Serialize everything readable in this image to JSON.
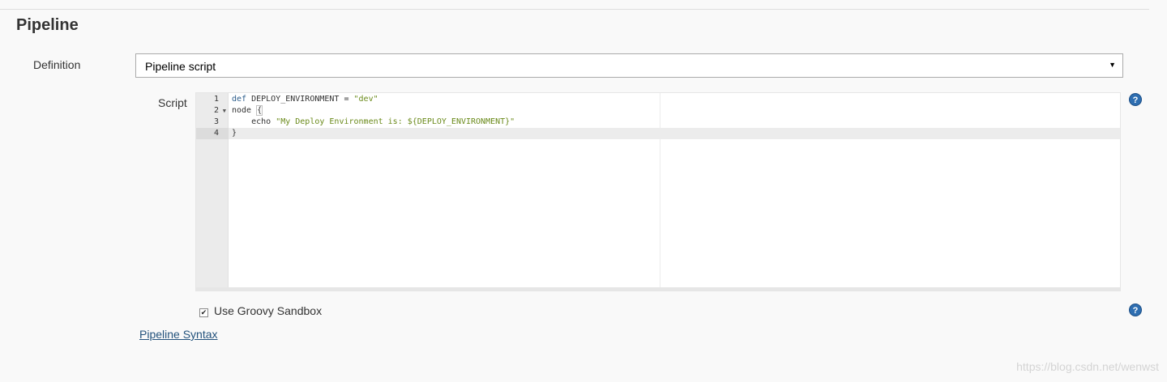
{
  "section": {
    "title": "Pipeline"
  },
  "definition": {
    "label": "Definition",
    "selected": "Pipeline script",
    "arrow": "▼"
  },
  "script": {
    "label": "Script",
    "lines": [
      {
        "num": "1",
        "tokens": [
          {
            "t": "def",
            "c": "kw"
          },
          {
            "t": " DEPLOY_ENVIRONMENT = ",
            "c": ""
          },
          {
            "t": "\"dev\"",
            "c": "str"
          }
        ]
      },
      {
        "num": "2",
        "fold": true,
        "tokens": [
          {
            "t": "node ",
            "c": ""
          },
          {
            "t": "{",
            "c": "brace"
          }
        ]
      },
      {
        "num": "3",
        "tokens": [
          {
            "t": "    echo ",
            "c": ""
          },
          {
            "t": "\"My Deploy Environment is: ${DEPLOY_ENVIRONMENT}\"",
            "c": "str"
          }
        ]
      },
      {
        "num": "4",
        "active": true,
        "tokens": [
          {
            "t": "}",
            "c": ""
          }
        ]
      }
    ]
  },
  "sandbox": {
    "label": "Use Groovy Sandbox",
    "checked": true
  },
  "syntax_link": {
    "label": "Pipeline Syntax"
  },
  "help_icon": {
    "glyph": "?",
    "color": "#2e6eb1",
    "icon": "help-icon"
  },
  "watermark": "https://blog.csdn.net/wenwst"
}
